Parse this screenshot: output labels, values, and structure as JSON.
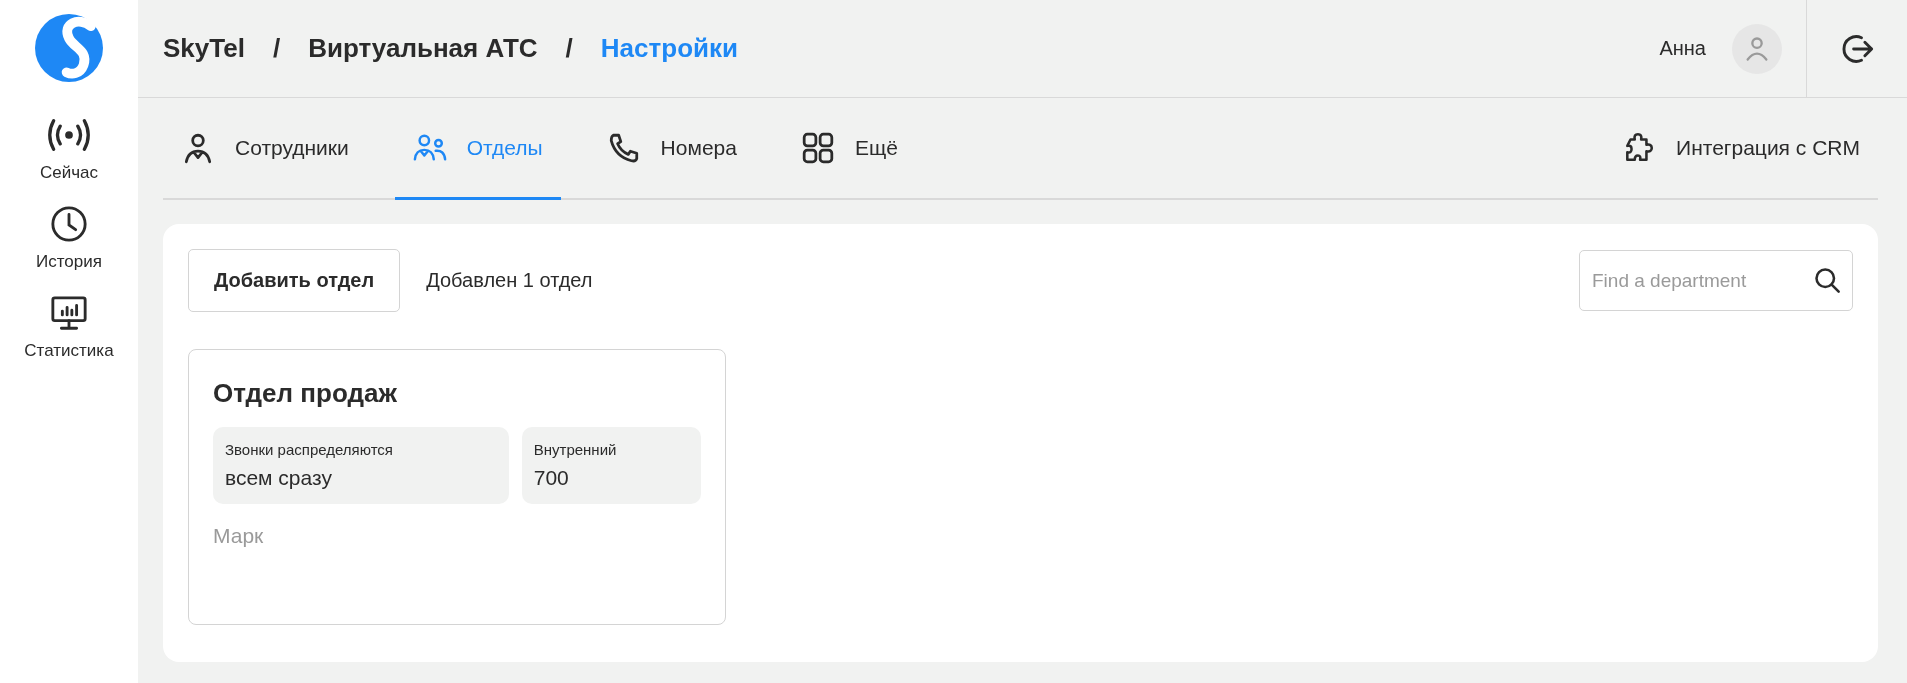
{
  "sidebar": {
    "items": [
      {
        "kind": "live",
        "label": "Сейчас"
      },
      {
        "kind": "history",
        "label": "История"
      },
      {
        "kind": "stats",
        "label": "Статистика"
      }
    ]
  },
  "breadcrumbs": [
    {
      "label": "SkyTel",
      "current": false
    },
    {
      "label": "Виртуальная АТС",
      "current": false
    },
    {
      "label": "Настройки",
      "current": true
    }
  ],
  "breadcrumb_separator": "/",
  "user": {
    "name": "Анна"
  },
  "tabs": [
    {
      "kind": "person",
      "label": "Сотрудники",
      "selected": false
    },
    {
      "kind": "people",
      "label": "Отделы",
      "selected": true
    },
    {
      "kind": "phone",
      "label": "Номера",
      "selected": false
    },
    {
      "kind": "grid",
      "label": "Ещё",
      "selected": false
    }
  ],
  "integration_link": "Интеграция с CRM",
  "toolbar": {
    "add_button": "Добавить отдел",
    "count_text": "Добавлен 1 отдел",
    "search": {
      "placeholder": "Find a department"
    }
  },
  "departments": [
    {
      "title": "Отдел продаж",
      "fields": [
        {
          "label": "Звонки распределяются",
          "value": "всем сразу"
        },
        {
          "label": "Внутренний",
          "value": "700"
        }
      ],
      "members": "Марк"
    }
  ]
}
